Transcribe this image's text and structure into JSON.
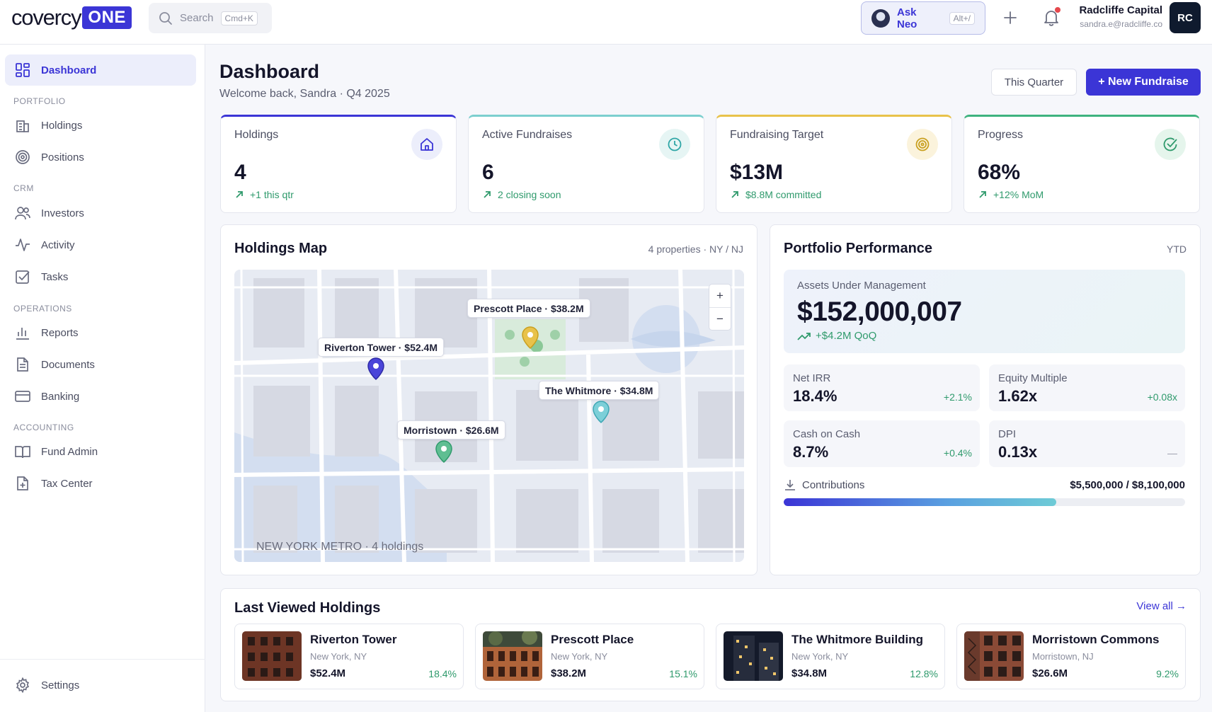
{
  "topbar": {
    "logo_word": "covercy",
    "logo_badge": "ONE",
    "search_placeholder": "Search",
    "search_shortcut": "Cmd+K",
    "ask_neo_label": "Ask Neo",
    "ask_neo_shortcut": "Alt+/",
    "notifications_unread": true,
    "user_name": "Radcliffe Capital",
    "user_email": "sandra.e@radcliffe.co",
    "user_initials": "RC"
  },
  "sidebar": {
    "dashboard": "Dashboard",
    "sections": {
      "portfolio": "PORTFOLIO",
      "crm": "CRM",
      "operations": "OPERATIONS",
      "accounting": "ACCOUNTING"
    },
    "items": {
      "holdings": "Holdings",
      "positions": "Positions",
      "investors": "Investors",
      "activity": "Activity",
      "tasks": "Tasks",
      "reports": "Reports",
      "documents": "Documents",
      "banking": "Banking",
      "fund_admin": "Fund Admin",
      "tax_center": "Tax Center"
    },
    "settings": "Settings"
  },
  "header": {
    "title": "Dashboard",
    "subtitle": "Welcome back, Sandra · Q4 2025",
    "period_button": "This Quarter",
    "new_button": "+ New Fundraise"
  },
  "stats": [
    {
      "label": "Holdings",
      "value": "4",
      "delta": "+1 this qtr",
      "accent": "#3b35d6",
      "icon": "home-icon"
    },
    {
      "label": "Active Fundraises",
      "value": "6",
      "delta": "2 closing soon",
      "accent": "#7ccfcf",
      "icon": "clock-icon"
    },
    {
      "label": "Fundraising Target",
      "value": "$13M",
      "delta": "$8.8M committed",
      "accent": "#e8c24a",
      "icon": "target-icon"
    },
    {
      "label": "Progress",
      "value": "68%",
      "delta": "+12% MoM",
      "accent": "#3fb37f",
      "icon": "check-circle-icon"
    }
  ],
  "map_panel": {
    "title": "Holdings Map",
    "meta": "4 properties · NY / NJ",
    "caption": "NEW YORK METRO · 4 holdings",
    "pins": {
      "prescott": "Prescott Place · $38.2M",
      "riverton": "Riverton Tower · $52.4M",
      "whitmore": "The Whitmore · $34.8M",
      "morristown": "Morristown · $26.6M"
    }
  },
  "performance": {
    "title": "Portfolio Performance",
    "period": "YTD",
    "aum_label": "Assets Under Management",
    "aum_value": "$152,000,007",
    "aum_delta": "+$4.2M QoQ",
    "metrics": [
      {
        "label": "Net IRR",
        "value": "18.4%",
        "delta": "+2.1%"
      },
      {
        "label": "Equity Multiple",
        "value": "1.62x",
        "delta": "+0.08x"
      },
      {
        "label": "Cash on Cash",
        "value": "8.7%",
        "delta": "+0.4%"
      },
      {
        "label": "DPI",
        "value": "0.13x",
        "delta": "—"
      }
    ],
    "contributions_label": "Contributions",
    "contributions_amount": "$5,500,000 / $8,100,000",
    "contributions_fraction": 0.679
  },
  "last_viewed": {
    "title": "Last Viewed Holdings",
    "view_all": "View all →",
    "items": [
      {
        "name": "Riverton Tower",
        "location": "New York, NY",
        "value": "$52.4M",
        "irr": "18.4%"
      },
      {
        "name": "Prescott Place",
        "location": "New York, NY",
        "value": "$38.2M",
        "irr": "15.1%"
      },
      {
        "name": "The Whitmore Building",
        "location": "New York, NY",
        "value": "$34.8M",
        "irr": "12.8%"
      },
      {
        "name": "Morristown Commons",
        "location": "Morristown, NJ",
        "value": "$26.6M",
        "irr": "9.2%"
      }
    ]
  }
}
